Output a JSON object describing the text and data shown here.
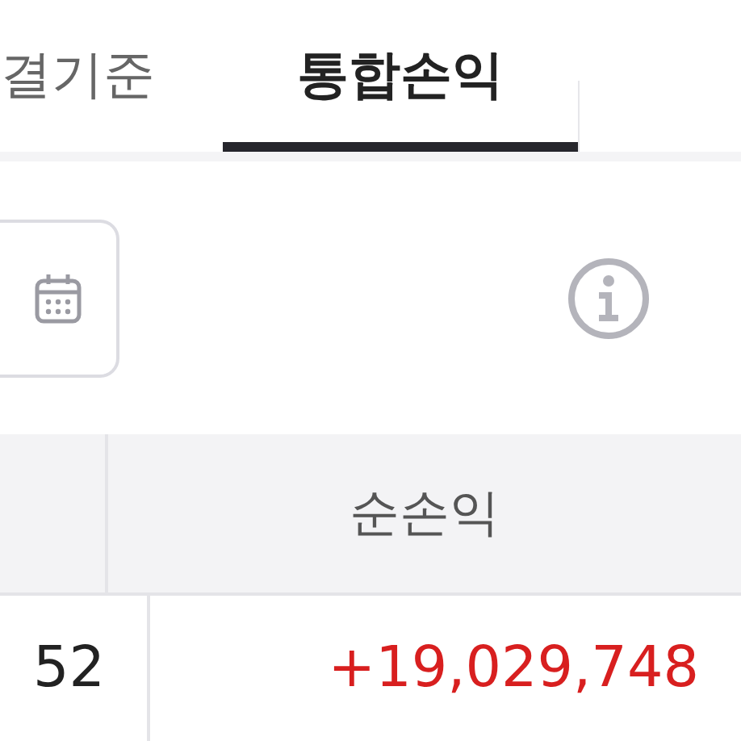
{
  "tabs": [
    {
      "label": "결기준",
      "selected": false
    },
    {
      "label": "통합손익",
      "selected": true
    }
  ],
  "table": {
    "columns": [
      "순손익"
    ],
    "rows": [
      {
        "column_1": "52",
        "net_profit": "+19,029,748"
      }
    ]
  }
}
